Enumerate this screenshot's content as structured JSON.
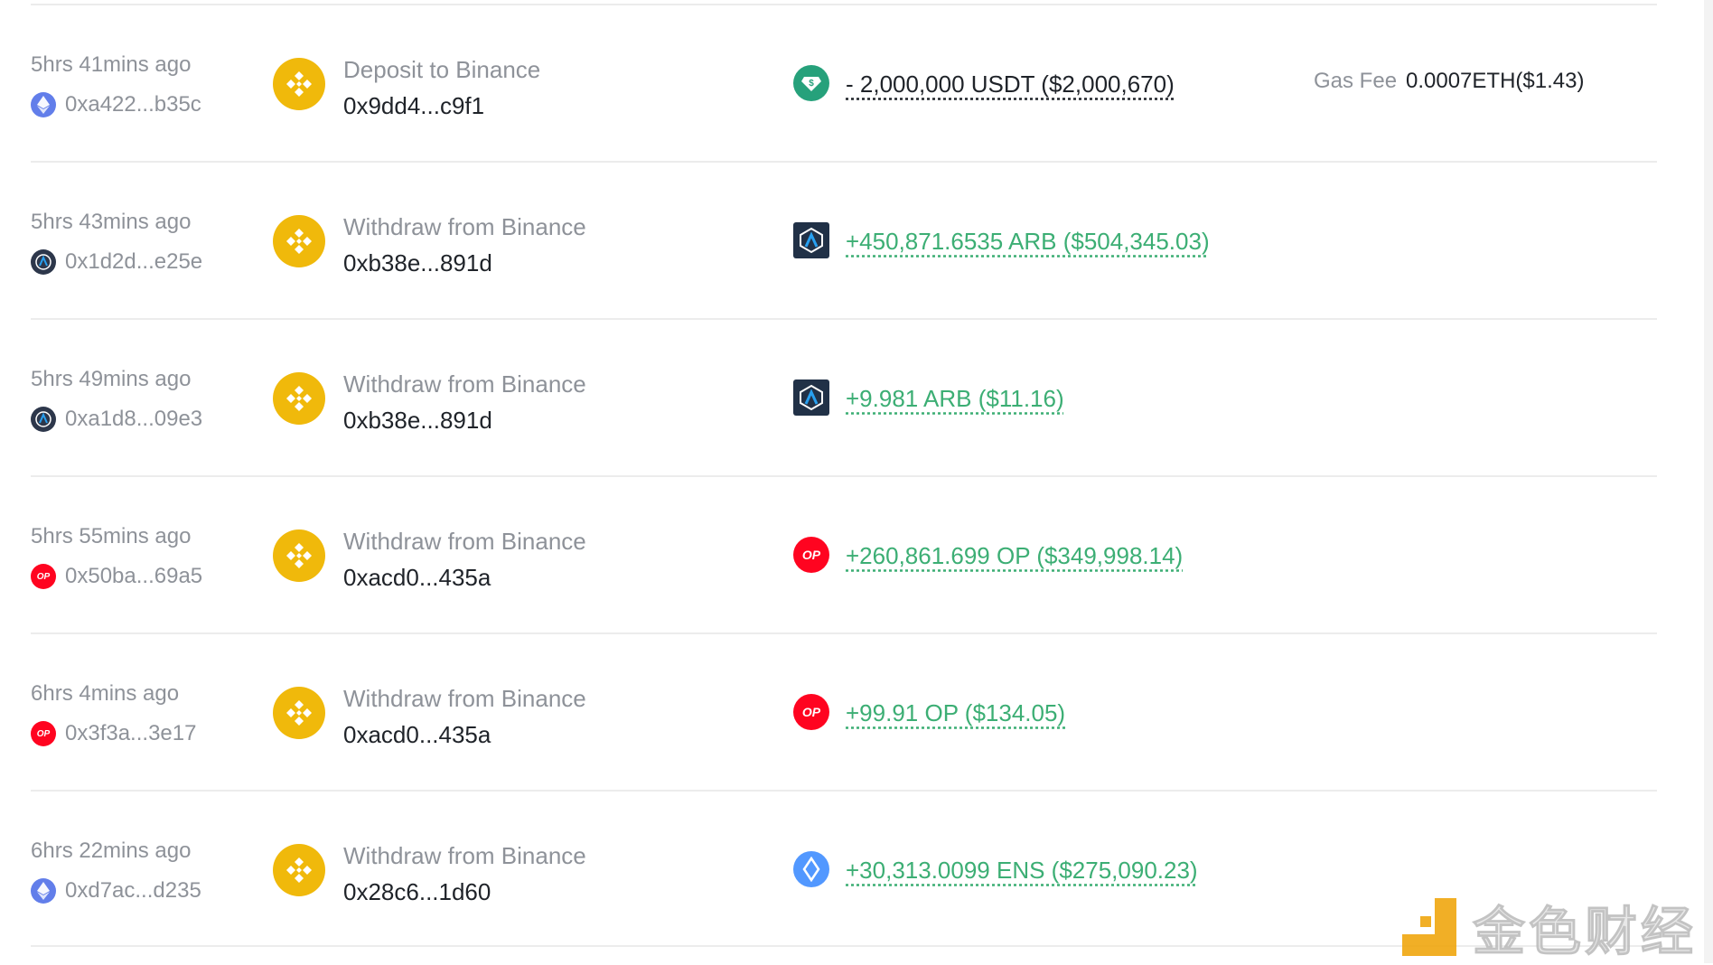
{
  "transactions": [
    {
      "time": "5hrs 41mins ago",
      "chain": "eth",
      "address": "0xa422...b35c",
      "action": "Deposit to Binance",
      "counterparty": "0x9dd4...c9f1",
      "token": "usdt",
      "amount": "- 2,000,000 USDT ($2,000,670)",
      "direction": "out",
      "gas_label": "Gas Fee",
      "gas_value": "0.0007ETH($1.43)"
    },
    {
      "time": "5hrs 43mins ago",
      "chain": "arb",
      "address": "0x1d2d...e25e",
      "action": "Withdraw from Binance",
      "counterparty": "0xb38e...891d",
      "token": "arb",
      "amount": "+450,871.6535 ARB ($504,345.03)",
      "direction": "in"
    },
    {
      "time": "5hrs 49mins ago",
      "chain": "arb",
      "address": "0xa1d8...09e3",
      "action": "Withdraw from Binance",
      "counterparty": "0xb38e...891d",
      "token": "arb",
      "amount": "+9.981 ARB ($11.16)",
      "direction": "in"
    },
    {
      "time": "5hrs 55mins ago",
      "chain": "op",
      "address": "0x50ba...69a5",
      "action": "Withdraw from Binance",
      "counterparty": "0xacd0...435a",
      "token": "op",
      "amount": "+260,861.699 OP ($349,998.14)",
      "direction": "in"
    },
    {
      "time": "6hrs 4mins ago",
      "chain": "op",
      "address": "0x3f3a...3e17",
      "action": "Withdraw from Binance",
      "counterparty": "0xacd0...435a",
      "token": "op",
      "amount": "+99.91 OP ($134.05)",
      "direction": "in"
    },
    {
      "time": "6hrs 22mins ago",
      "chain": "eth",
      "address": "0xd7ac...d235",
      "action": "Withdraw from Binance",
      "counterparty": "0x28c6...1d60",
      "token": "ens",
      "amount": "+30,313.0099 ENS ($275,090.23)",
      "direction": "in"
    }
  ],
  "icons": {
    "op_text": "OP"
  },
  "watermark": {
    "text": "金色财经"
  },
  "colors": {
    "positive": "#3cae74",
    "binance": "#f0b90b",
    "muted": "#8e9299"
  }
}
